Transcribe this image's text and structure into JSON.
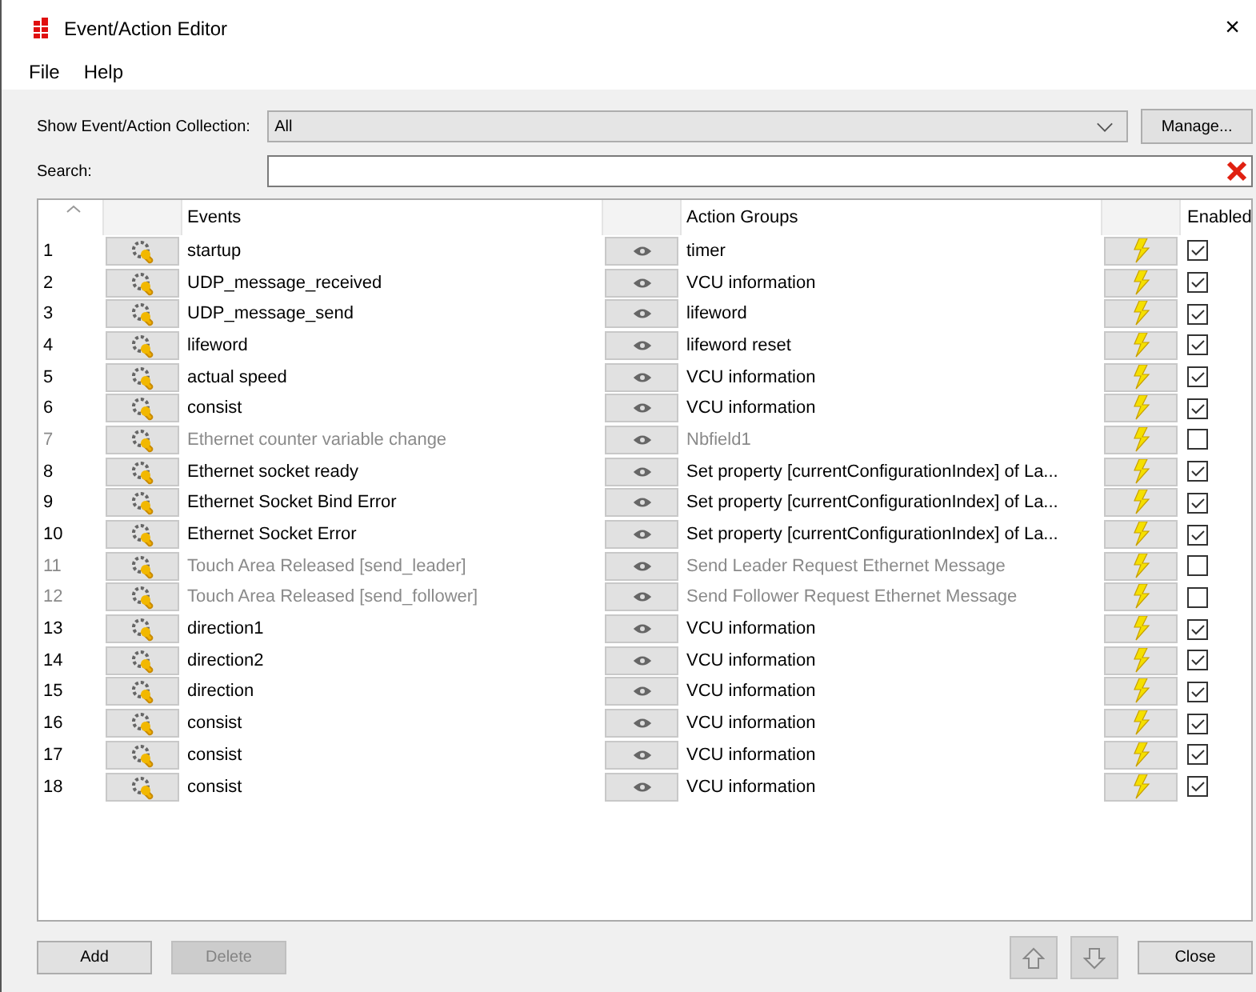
{
  "window": {
    "title": "Event/Action Editor",
    "close": "×"
  },
  "menu": [
    "File",
    "Help"
  ],
  "collection": {
    "label": "Show Event/Action Collection:",
    "value": "All",
    "manage": "Manage..."
  },
  "search": {
    "label": "Search:"
  },
  "table": {
    "columns": [
      "Events",
      "Action Groups",
      "Enabled"
    ],
    "rows": [
      {
        "number": "1",
        "event": "startup",
        "action": "timer",
        "enabled": true
      },
      {
        "number": "2",
        "event": "UDP_message_received",
        "action": "VCU information",
        "enabled": true
      },
      {
        "number": "3",
        "event": "UDP_message_send",
        "action": "lifeword",
        "enabled": true
      },
      {
        "number": "4",
        "event": "lifeword",
        "action": "lifeword reset",
        "enabled": true
      },
      {
        "number": "5",
        "event": "actual speed",
        "action": "VCU information",
        "enabled": true
      },
      {
        "number": "6",
        "event": "consist",
        "action": "VCU information",
        "enabled": true
      },
      {
        "number": "7",
        "event": "Ethernet counter variable change",
        "action": "Nbfield1",
        "enabled": false
      },
      {
        "number": "8",
        "event": "Ethernet socket ready",
        "action": "Set property [currentConfigurationIndex] of La...",
        "enabled": true
      },
      {
        "number": "9",
        "event": "Ethernet Socket Bind Error",
        "action": "Set property [currentConfigurationIndex] of La...",
        "enabled": true
      },
      {
        "number": "10",
        "event": "Ethernet Socket Error",
        "action": "Set property [currentConfigurationIndex] of La...",
        "enabled": true
      },
      {
        "number": "11",
        "event": "Touch Area Released [send_leader]",
        "action": "Send Leader Request Ethernet Message",
        "enabled": false
      },
      {
        "number": "12",
        "event": "Touch Area Released [send_follower]",
        "action": "Send Follower Request Ethernet Message",
        "enabled": false
      },
      {
        "number": "13",
        "event": "direction1",
        "action": "VCU information",
        "enabled": true
      },
      {
        "number": "14",
        "event": "direction2",
        "action": "VCU information",
        "enabled": true
      },
      {
        "number": "15",
        "event": "direction",
        "action": "VCU information",
        "enabled": true
      },
      {
        "number": "16",
        "event": "consist",
        "action": "VCU information",
        "enabled": true
      },
      {
        "number": "17",
        "event": "consist",
        "action": "VCU information",
        "enabled": true
      },
      {
        "number": "18",
        "event": "consist",
        "action": "VCU information",
        "enabled": true
      }
    ]
  },
  "buttons": [
    {
      "label": "Add",
      "disabled": false
    },
    {
      "label": "Delete",
      "disabled": true
    }
  ],
  "close_button": "Close"
}
